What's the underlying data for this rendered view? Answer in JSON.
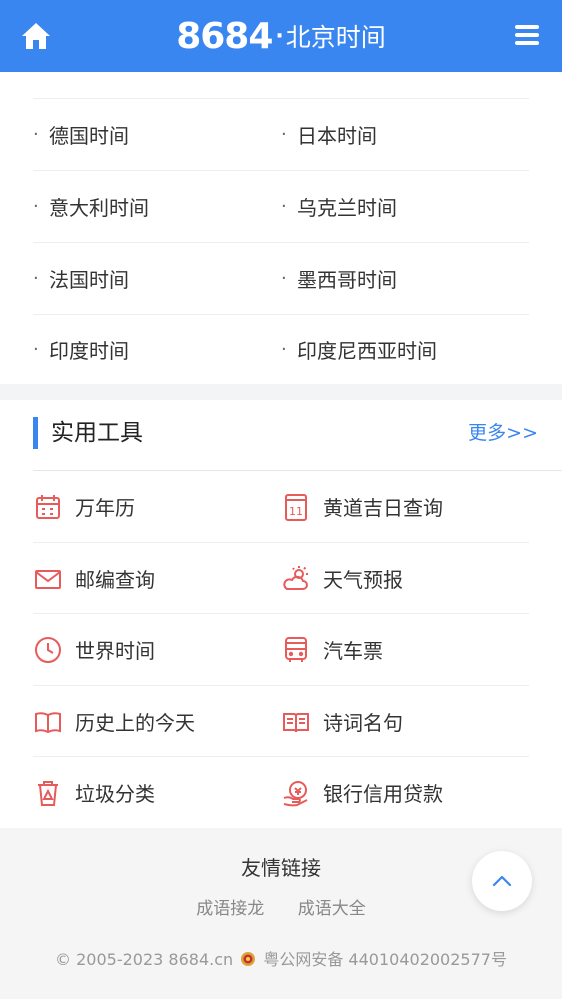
{
  "header": {
    "brand_num": "8684",
    "brand_dot": "·",
    "brand_title": "北京时间"
  },
  "countries": [
    {
      "left": "德国时间",
      "right": "日本时间"
    },
    {
      "left": "意大利时间",
      "right": "乌克兰时间"
    },
    {
      "left": "法国时间",
      "right": "墨西哥时间"
    },
    {
      "left": "印度时间",
      "right": "印度尼西亚时间"
    }
  ],
  "bullet": "·",
  "tools": {
    "title": "实用工具",
    "more": "更多>>",
    "items": [
      {
        "left": "万年历",
        "left_icon": "calendar-icon",
        "right": "黄道吉日查询",
        "right_icon": "date-11-icon"
      },
      {
        "left": "邮编查询",
        "left_icon": "mail-icon",
        "right": "天气预报",
        "right_icon": "weather-icon"
      },
      {
        "left": "世界时间",
        "left_icon": "clock-icon",
        "right": "汽车票",
        "right_icon": "bus-icon"
      },
      {
        "left": "历史上的今天",
        "left_icon": "book-open-icon",
        "right": "诗词名句",
        "right_icon": "poem-book-icon"
      },
      {
        "left": "垃圾分类",
        "left_icon": "trash-icon",
        "right": "银行信用贷款",
        "right_icon": "loan-icon"
      }
    ],
    "icon_color": "#e85b5b"
  },
  "footer": {
    "title": "友情链接",
    "links": [
      "成语接龙",
      "成语大全"
    ],
    "copyright_prefix": "© 2005-2023 8684.cn",
    "copyright_suffix": "粤公网安备 44010402002577号"
  },
  "colors": {
    "primary": "#3a86f0",
    "footer_bg": "#f5f5f5"
  }
}
